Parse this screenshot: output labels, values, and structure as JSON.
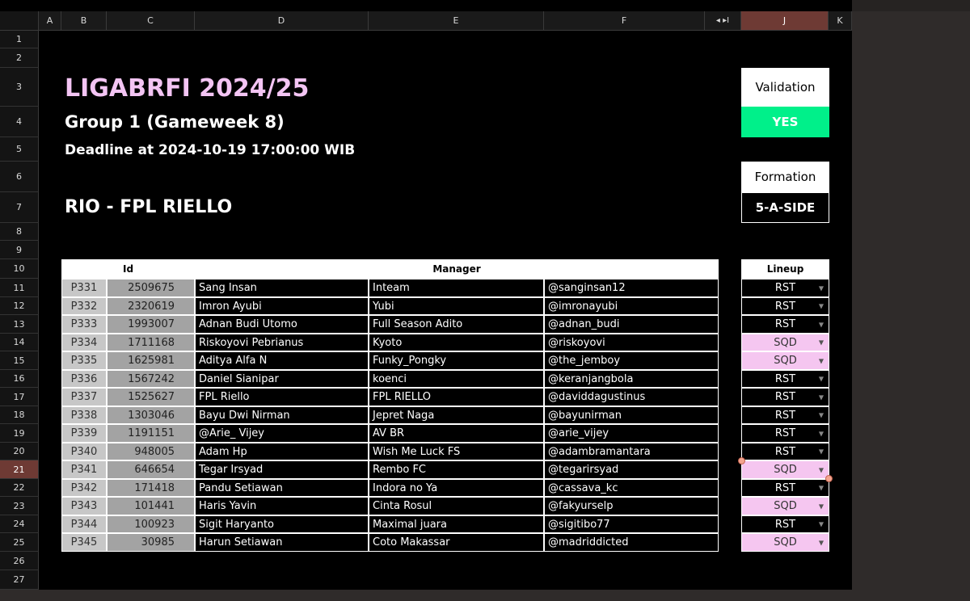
{
  "columns": [
    "A",
    "B",
    "C",
    "D",
    "E",
    "F",
    "J",
    "K"
  ],
  "rows": [
    "1",
    "2",
    "3",
    "4",
    "5",
    "6",
    "7",
    "8",
    "9",
    "10",
    "11",
    "12",
    "13",
    "14",
    "15",
    "16",
    "17",
    "18",
    "19",
    "20",
    "21",
    "22",
    "23",
    "24",
    "25",
    "26",
    "27"
  ],
  "nav_arrows": "◂ ▸I",
  "title": "LIGABRFI 2024/25",
  "group": "Group 1 (Gameweek 8)",
  "deadline": "Deadline at 2024-10-19 17:00:00 WIB",
  "team": "RIO - FPL RIELLO",
  "validation": {
    "label": "Validation",
    "value": "YES"
  },
  "formation": {
    "label": "Formation",
    "value": "5-A-SIDE"
  },
  "table": {
    "id_header": "Id",
    "manager_header": "Manager",
    "lineup_header": "Lineup",
    "rows": [
      {
        "code": "P331",
        "id": "2509675",
        "name": "Sang Insan",
        "team": "Inteam",
        "handle": "@sanginsan12",
        "lineup": "RST"
      },
      {
        "code": "P332",
        "id": "2320619",
        "name": "Imron Ayubi",
        "team": "Yubi",
        "handle": "@imronayubi",
        "lineup": "RST"
      },
      {
        "code": "P333",
        "id": "1993007",
        "name": "Adnan Budi Utomo",
        "team": "Full Season Adito",
        "handle": "@adnan_budi",
        "lineup": "RST"
      },
      {
        "code": "P334",
        "id": "1711168",
        "name": "Riskoyovi Pebrianus",
        "team": "Kyoto",
        "handle": "@riskoyovi",
        "lineup": "SQD"
      },
      {
        "code": "P335",
        "id": "1625981",
        "name": "Aditya Alfa N",
        "team": "Funky_Pongky",
        "handle": "@the_jemboy",
        "lineup": "SQD"
      },
      {
        "code": "P336",
        "id": "1567242",
        "name": "Daniel Sianipar",
        "team": "koenci",
        "handle": "@keranjangbola",
        "lineup": "RST"
      },
      {
        "code": "P337",
        "id": "1525627",
        "name": "FPL Riello",
        "team": "FPL RIELLO",
        "handle": "@daviddagustinus",
        "lineup": "RST"
      },
      {
        "code": "P338",
        "id": "1303046",
        "name": "Bayu Dwi Nirman",
        "team": "Jepret Naga",
        "handle": "@bayunirman",
        "lineup": "RST"
      },
      {
        "code": "P339",
        "id": "1191151",
        "name": "@Arie_ Vijey",
        "team": "AV BR",
        "handle": "@arie_vijey",
        "lineup": "RST"
      },
      {
        "code": "P340",
        "id": "948005",
        "name": "Adam Hp",
        "team": "Wish Me Luck FS",
        "handle": "@adambramantara",
        "lineup": "RST"
      },
      {
        "code": "P341",
        "id": "646654",
        "name": "Tegar Irsyad",
        "team": "Rembo FC",
        "handle": "@tegarirsyad",
        "lineup": "SQD"
      },
      {
        "code": "P342",
        "id": "171418",
        "name": "Pandu Setiawan",
        "team": "Indora no Ya",
        "handle": "@cassava_kc",
        "lineup": "RST"
      },
      {
        "code": "P343",
        "id": "101441",
        "name": "Haris Yavin",
        "team": "Cinta Rosul",
        "handle": "@fakyurselp",
        "lineup": "SQD"
      },
      {
        "code": "P344",
        "id": "100923",
        "name": "Sigit Haryanto",
        "team": "Maximal juara",
        "handle": "@sigitibo77",
        "lineup": "RST"
      },
      {
        "code": "P345",
        "id": "30985",
        "name": "Harun Setiawan",
        "team": "Coto Makassar",
        "handle": "@madriddicted",
        "lineup": "SQD"
      }
    ]
  },
  "colors": {
    "title_pink": "#f3c4f3",
    "yes_green": "#00f08a",
    "sqd_pink": "#f5c6f0",
    "selected_header": "#6e3a34"
  }
}
